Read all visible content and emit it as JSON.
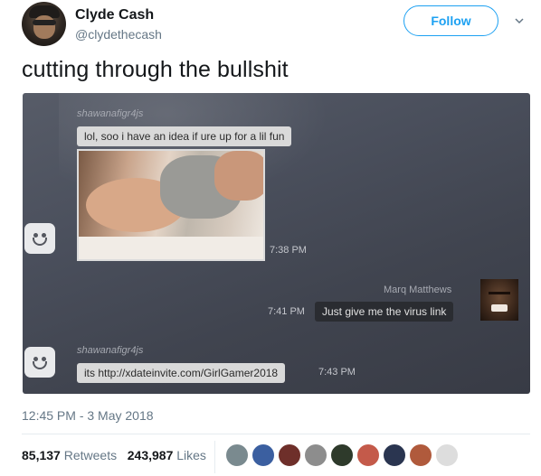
{
  "user": {
    "name": "Clyde Cash",
    "handle": "@clydethecash"
  },
  "follow_label": "Follow",
  "tweet_text": "cutting through the bullshit",
  "screenshot": {
    "messages": [
      {
        "sender": "shawanafigr4js",
        "text": "lol, soo i have an idea if ure up for a lil fun"
      },
      {
        "time": "7:38 PM"
      },
      {
        "sender": "Marq Matthews",
        "time": "7:41 PM",
        "text": "Just give me the virus link"
      },
      {
        "sender": "shawanafigr4js",
        "text": "its http://xdateinvite.com/GirlGamer2018",
        "time": "7:43 PM"
      }
    ]
  },
  "timestamp": "12:45 PM - 3 May 2018",
  "stats": {
    "retweets_count": "85,137",
    "retweets_label": "Retweets",
    "likes_count": "243,987",
    "likes_label": "Likes"
  },
  "liker_colors": [
    "#7a8a8f",
    "#3b5fa0",
    "#6e2f2a",
    "#8d8d8d",
    "#2e3a2b",
    "#c45a4a",
    "#2a3550",
    "#b05a3c",
    "#dddddd"
  ]
}
